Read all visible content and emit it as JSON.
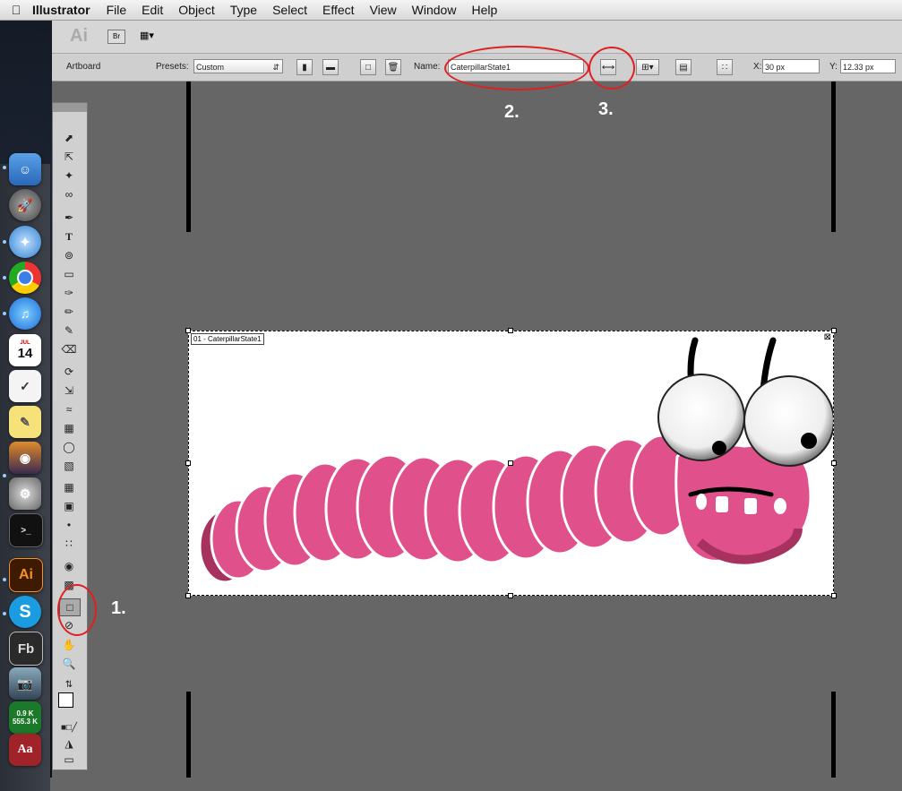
{
  "menubar": {
    "app_name": "Illustrator",
    "items": [
      "File",
      "Edit",
      "Object",
      "Type",
      "Select",
      "Effect",
      "View",
      "Window",
      "Help"
    ]
  },
  "appbar": {
    "ai_logo": "Ai",
    "bridge": "Br"
  },
  "control": {
    "mode_label": "Artboard",
    "presets_label": "Presets:",
    "presets_value": "Custom",
    "name_label": "Name:",
    "name_value": "CaterpillarState1",
    "x_label": "X:",
    "x_value": "30 px",
    "y_label": "Y:",
    "y_value": "12.33 px"
  },
  "artboard": {
    "label": "01 - CaterpillarState1"
  },
  "annotations": [
    "1.",
    "2.",
    "3."
  ],
  "dock": {
    "ai": "Ai",
    "fb": "Fb",
    "calendar_day": "14",
    "net_up": "0.9 K",
    "net_down": "555.3 K",
    "dict": "Aa"
  },
  "colors": {
    "caterpillar_pink": "#e0508a",
    "callout_red": "#e02020",
    "canvas_gray": "#666666"
  }
}
